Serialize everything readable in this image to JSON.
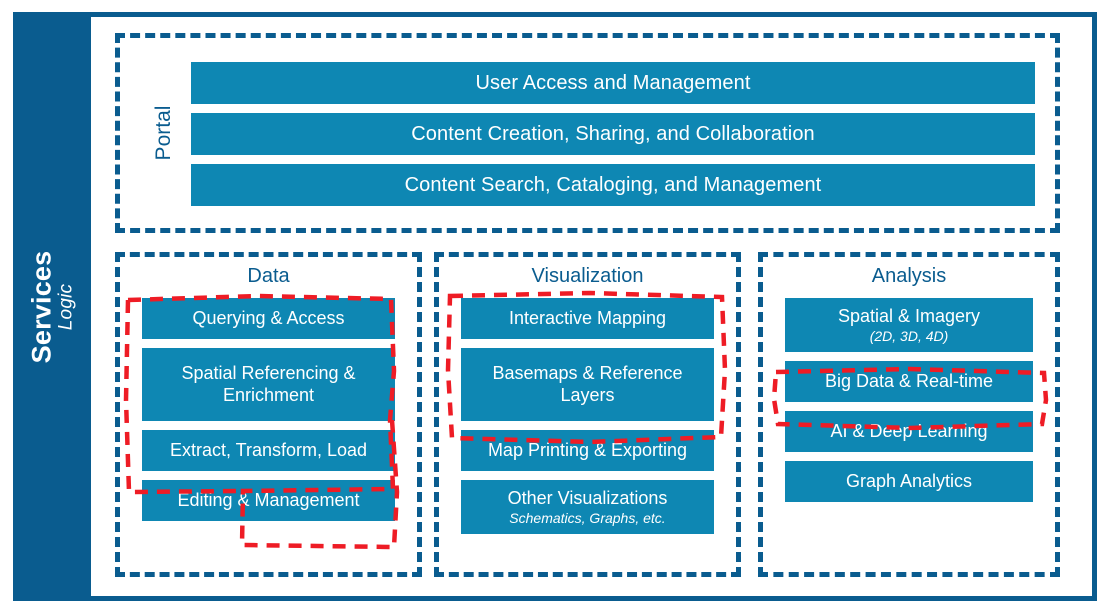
{
  "sidebar": {
    "title": "Services",
    "subtitle": "Logic"
  },
  "portal": {
    "label": "Portal",
    "bars": [
      {
        "label": "User Access and Management"
      },
      {
        "label": "Content Creation, Sharing, and Collaboration"
      },
      {
        "label": "Content Search, Cataloging, and Management"
      }
    ]
  },
  "columns": [
    {
      "title": "Data",
      "items": [
        {
          "label": "Querying & Access",
          "sub": ""
        },
        {
          "label": "Spatial Referencing & Enrichment",
          "sub": ""
        },
        {
          "label": "Extract, Transform, Load",
          "sub": ""
        },
        {
          "label": "Editing & Management",
          "sub": ""
        }
      ]
    },
    {
      "title": "Visualization",
      "items": [
        {
          "label": "Interactive Mapping",
          "sub": ""
        },
        {
          "label": "Basemaps & Reference Layers",
          "sub": ""
        },
        {
          "label": "Map Printing & Exporting",
          "sub": ""
        },
        {
          "label": "Other Visualizations",
          "sub": "Schematics, Graphs, etc."
        }
      ]
    },
    {
      "title": "Analysis",
      "items": [
        {
          "label": "Spatial & Imagery",
          "sub": "(2D, 3D, 4D)"
        },
        {
          "label": "Big Data & Real-time",
          "sub": ""
        },
        {
          "label": "AI & Deep Learning",
          "sub": ""
        },
        {
          "label": "Graph Analytics",
          "sub": ""
        }
      ]
    }
  ],
  "colors": {
    "navy": "#0a5c8f",
    "teal": "#0e87b3",
    "highlight_red": "#ee1c25",
    "background": "#ffffff"
  },
  "annotations": [
    {
      "name": "data-highlight",
      "covers": "Querying & Access, Spatial Referencing & Enrichment, Extract, Transform, Load, Editing & Management"
    },
    {
      "name": "visualization-highlight",
      "covers": "Interactive Mapping, Basemaps & Reference Layers"
    },
    {
      "name": "analysis-highlight",
      "covers": "Big Data & Real-time"
    }
  ]
}
